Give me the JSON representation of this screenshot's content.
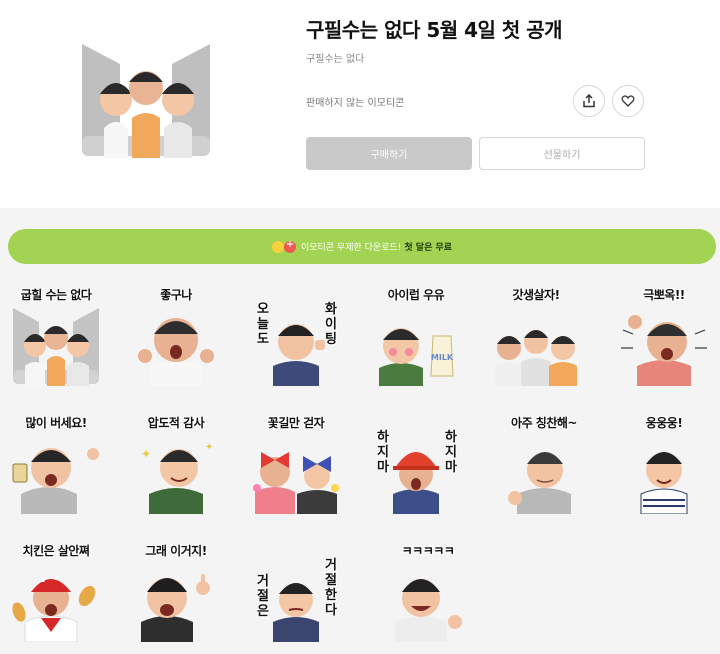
{
  "product": {
    "title": "구필수는 없다 5월 4일 첫 공개",
    "author": "구필수는 없다",
    "sale_note": "판매하지 않는 이모티콘",
    "buy_label": "구매하기",
    "gift_label": "선물하기",
    "share_icon": "share-icon",
    "like_icon": "heart-icon"
  },
  "promo": {
    "text": "이모티콘 무제한 다운로드!",
    "highlight": "첫 달은 무료"
  },
  "colors": {
    "promo_green": "#a2d352",
    "disabled_gray": "#c9c9c9",
    "background": "#f4f4f4"
  },
  "stickers": [
    {
      "caption": "굽힐 수는 없다"
    },
    {
      "caption": "좋구나"
    },
    {
      "left": "오늘도",
      "right": "화이팅"
    },
    {
      "caption": "아이럽 우유",
      "badge": "MILK"
    },
    {
      "caption": "갓생살자!"
    },
    {
      "caption": "극뽀옥!!"
    },
    {
      "caption": "많이 버세요!"
    },
    {
      "caption": "압도적 감사"
    },
    {
      "caption": "꽃길만 걷자"
    },
    {
      "left": "하지마",
      "right": "하지마"
    },
    {
      "caption": "아주 칭찬해~"
    },
    {
      "caption": "웅웅웅!"
    },
    {
      "caption": "치킨은 살안쪄"
    },
    {
      "caption": "그래 이거지!"
    },
    {
      "left": "거절은",
      "right": "거절한다"
    },
    {
      "caption": "ㅋㅋㅋㅋㅋ"
    }
  ]
}
